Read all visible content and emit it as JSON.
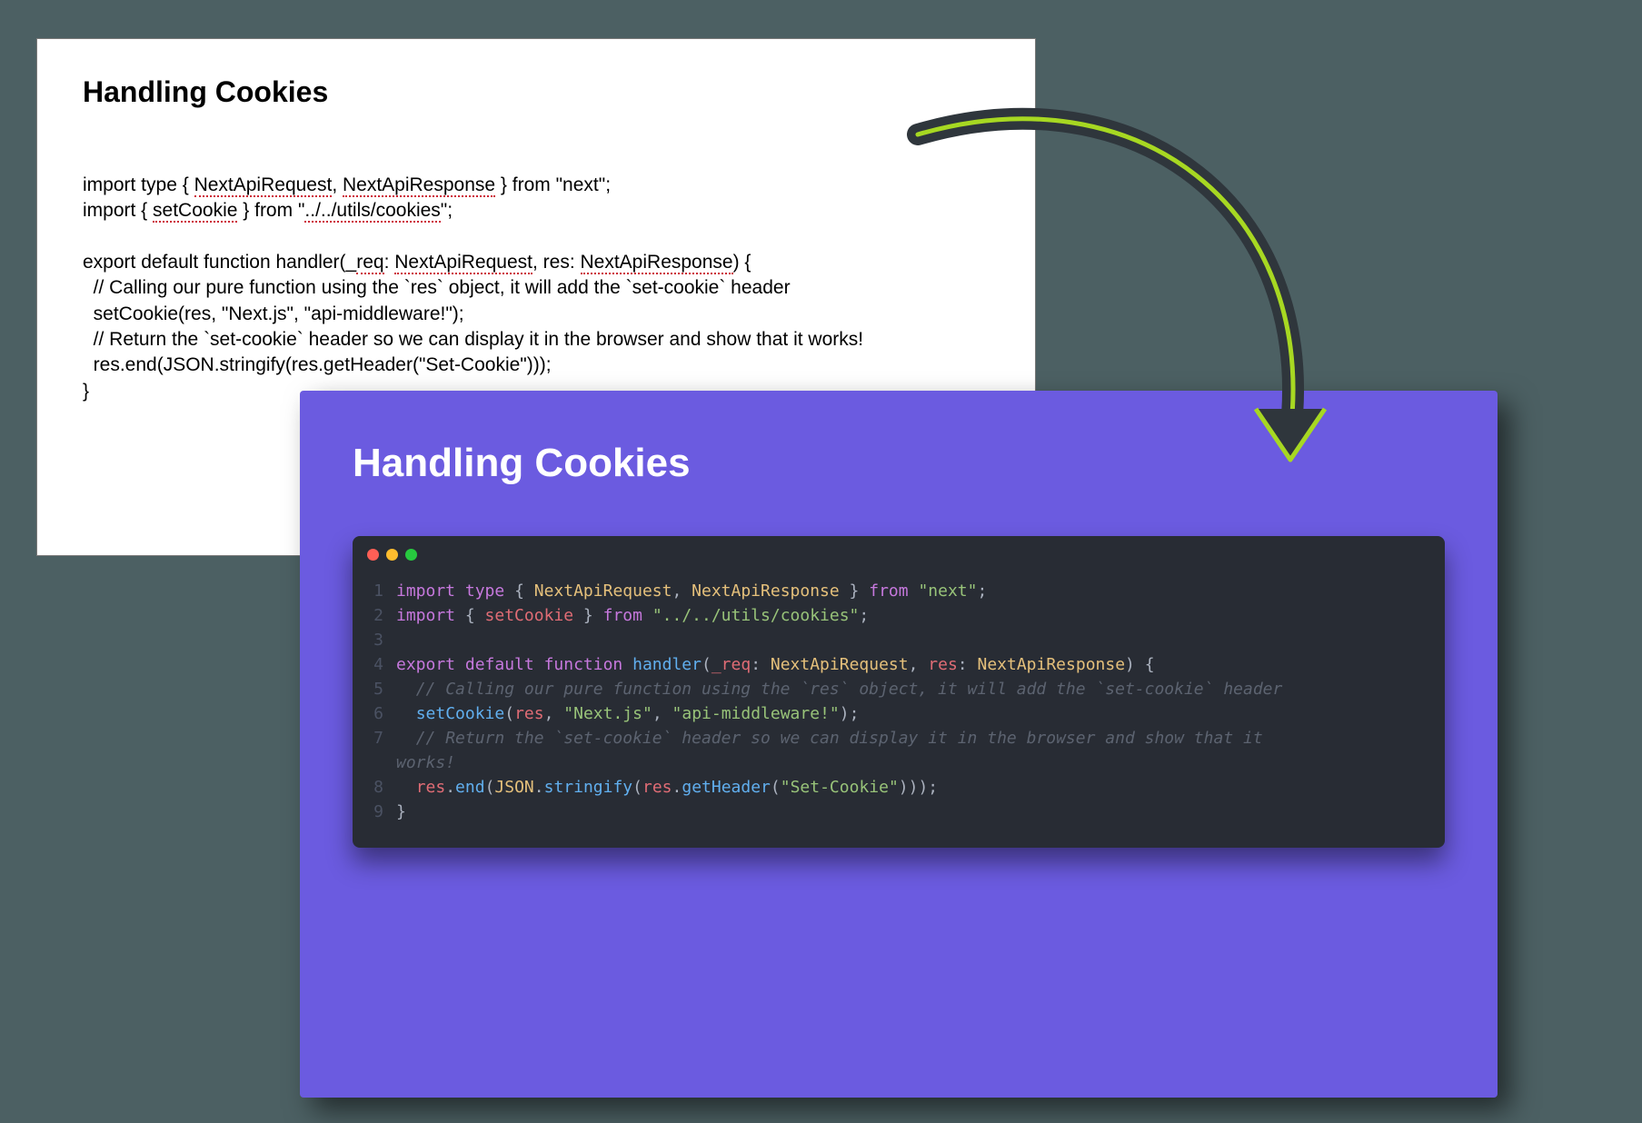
{
  "doc": {
    "title": "Handling Cookies",
    "code": {
      "l1a": "import type { ",
      "l1b": "NextApiRequest",
      "l1c": ", ",
      "l1d": "NextApiResponse",
      "l1e": " } from \"next\";",
      "l2a": "import { ",
      "l2b": "setCookie",
      "l2c": " } from \"",
      "l2d": "../../utils/cookies",
      "l2e": "\";",
      "blank": "",
      "l4a": "export default function handler(_",
      "l4b": "req",
      "l4c": ": ",
      "l4d": "NextApiRequest",
      "l4e": ", res: ",
      "l4f": "NextApiResponse",
      "l4g": ") {",
      "l5": "  // Calling our pure function using the `res` object, it will add the `set-cookie` header",
      "l6": "  setCookie(res, \"Next.js\", \"api-middleware!\");",
      "l7": "  // Return the `set-cookie` header so we can display it in the browser and show that it works!",
      "l8": "  res.end(JSON.stringify(res.getHeader(\"Set-Cookie\")));",
      "l9": "}"
    }
  },
  "slide": {
    "title": "Handling Cookies",
    "lineNumbers": [
      "1",
      "2",
      "3",
      "4",
      "5",
      "6",
      "7",
      "",
      "8",
      "9"
    ],
    "code": {
      "l1": {
        "a": "import",
        "b": " type ",
        "c": "{ ",
        "d": "NextApiRequest",
        "e": ", ",
        "f": "NextApiResponse",
        "g": " } ",
        "h": "from",
        "i": " ",
        "j": "\"next\"",
        "k": ";"
      },
      "l2": {
        "a": "import",
        "b": " { ",
        "c": "setCookie",
        "d": " } ",
        "e": "from",
        "f": " ",
        "g": "\"../../utils/cookies\"",
        "h": ";"
      },
      "l3": "",
      "l4": {
        "a": "export",
        "b": " ",
        "c": "default",
        "d": " ",
        "e": "function",
        "f": " ",
        "g": "handler",
        "h": "(",
        "i": "_req",
        "j": ": ",
        "k": "NextApiRequest",
        "l": ", ",
        "m": "res",
        "n": ": ",
        "o": "NextApiResponse",
        "p": ") {"
      },
      "l5": "  // Calling our pure function using the `res` object, it will add the `set-cookie` header",
      "l6": {
        "a": "  ",
        "b": "setCookie",
        "c": "(",
        "d": "res",
        "e": ", ",
        "f": "\"Next.js\"",
        "g": ", ",
        "h": "\"api-middleware!\"",
        "i": ");"
      },
      "l7a": "  // Return the `set-cookie` header so we can display it in the browser and show that it ",
      "l7b": "works!",
      "l8": {
        "a": "  ",
        "b": "res",
        "c": ".",
        "d": "end",
        "e": "(",
        "f": "JSON",
        "g": ".",
        "h": "stringify",
        "i": "(",
        "j": "res",
        "k": ".",
        "l": "getHeader",
        "m": "(",
        "n": "\"Set-Cookie\"",
        "o": ")));"
      },
      "l9": "}"
    }
  }
}
